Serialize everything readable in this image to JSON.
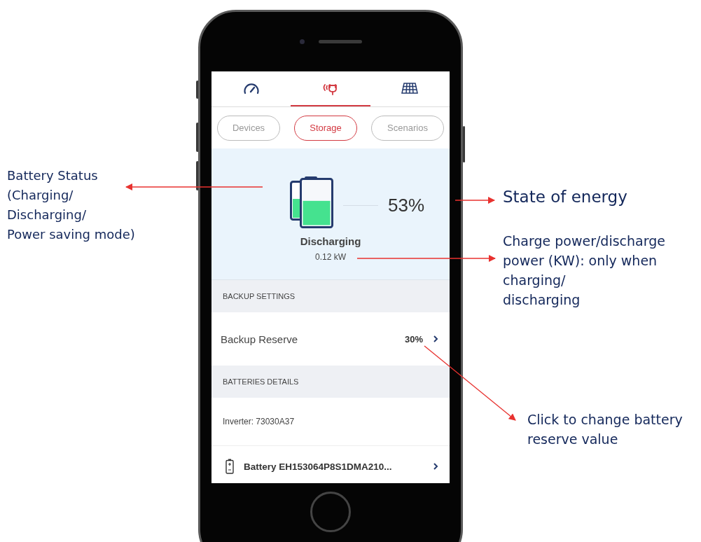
{
  "tabs": [
    {
      "selected": false
    },
    {
      "selected": true
    },
    {
      "selected": false
    }
  ],
  "segments": [
    {
      "label": "Devices",
      "selected": false
    },
    {
      "label": "Storage",
      "selected": true
    },
    {
      "label": "Scenarios",
      "selected": false
    }
  ],
  "status": {
    "level": 0.55,
    "percent": "53%",
    "state": "Discharging",
    "power": "0.12 kW"
  },
  "sections": [
    {
      "header": "BACKUP SETTINGS",
      "rows": [
        {
          "kind": "setting",
          "label": "Backup Reserve",
          "value": "30%"
        }
      ]
    },
    {
      "header": "BATTERIES DETAILS",
      "rows": [
        {
          "kind": "info",
          "label": "Inverter: 73030A37"
        },
        {
          "kind": "battery",
          "label": "Battery EH153064P8S1DMA210..."
        }
      ]
    }
  ],
  "annotations": [
    {
      "text": "Battery Status\n(Charging/\nDischarging/\nPower saving mode)"
    },
    {
      "text": "State of energy"
    },
    {
      "text": "Charge power/discharge\npower (KW): only when\ncharging/\ndischarging"
    },
    {
      "text": "Click to change battery\nreserve value"
    }
  ]
}
